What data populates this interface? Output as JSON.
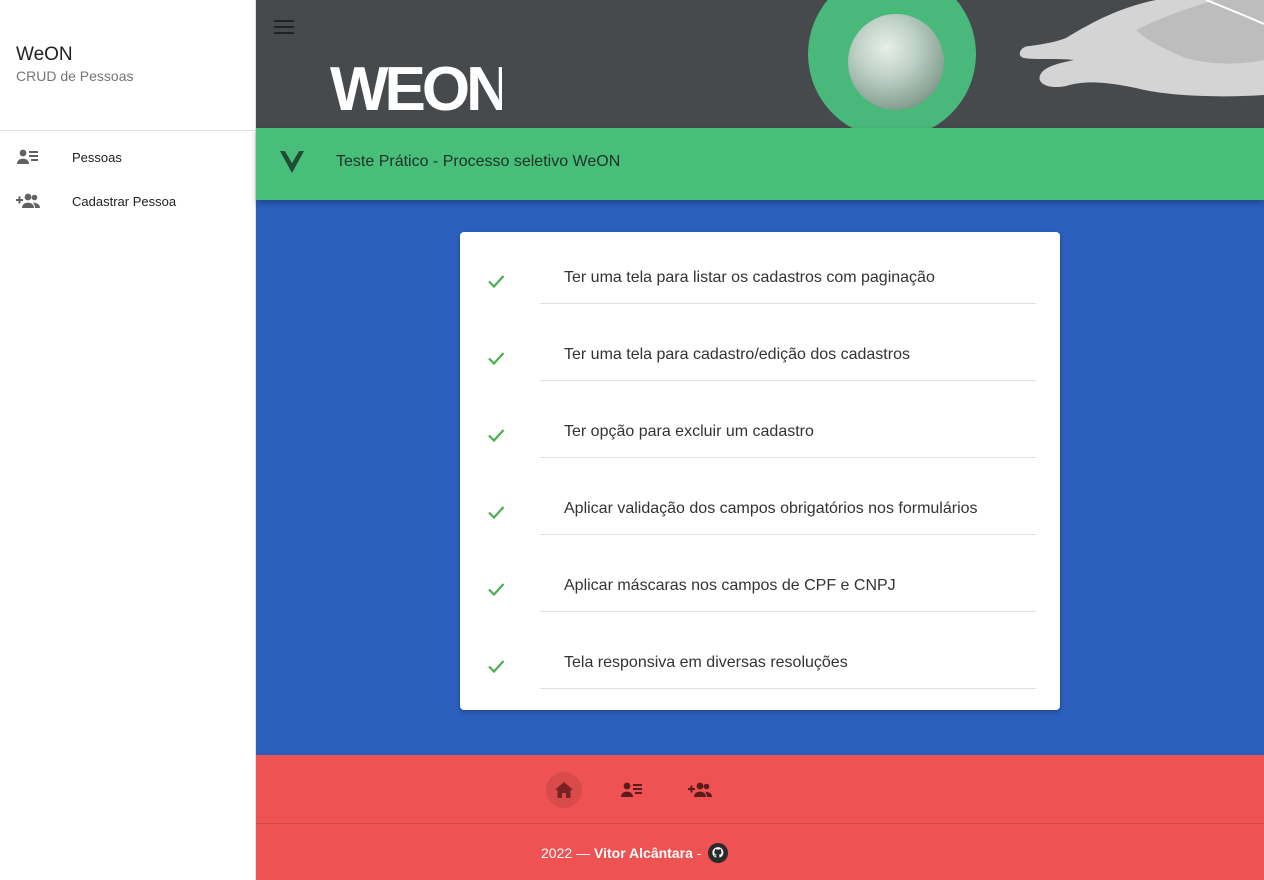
{
  "sidebar": {
    "title": "WeON",
    "subtitle": "CRUD de Pessoas",
    "items": [
      {
        "label": "Pessoas",
        "icon": "person-list-icon"
      },
      {
        "label": "Cadastrar Pessoa",
        "icon": "add-person-icon"
      }
    ]
  },
  "header": {
    "logo_text": "WEON",
    "app_title": "Teste Prático - Processo seletivo WeON"
  },
  "checklist": [
    "Ter uma tela para listar os cadastros com paginação",
    "Ter uma tela para cadastro/edição dos cadastros",
    "Ter opção para excluir um cadastro",
    "Aplicar validação dos campos obrigatórios nos formulários",
    "Aplicar máscaras nos campos de CPF e CNPJ",
    "Tela responsiva em diversas resoluções"
  ],
  "footer": {
    "year_text": "2022 —",
    "author": "Vitor Alcântara",
    "separator": "-",
    "nav_icons": [
      "home-icon",
      "person-list-icon",
      "add-person-icon"
    ]
  },
  "colors": {
    "hero_bg": "#474a4d",
    "appbar": "#48be7b",
    "content_bg": "#2a5fbd",
    "footer_bg": "#ee5252",
    "check": "#4caf50"
  }
}
